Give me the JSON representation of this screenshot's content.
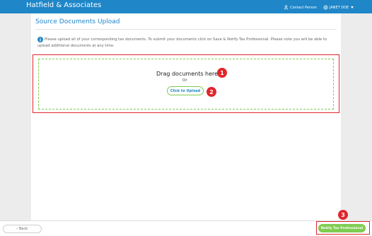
{
  "header": {
    "brand": "Hatfield & Associates",
    "contact_label": "Contact Person",
    "user_label": "JANET DOE",
    "icons": {
      "contact": "person-icon",
      "user": "settings-gear-icon",
      "user_menu": "chevron-down-icon"
    }
  },
  "page": {
    "title": "Source Documents Upload",
    "info": "Please upload all of your corresponding tax documents. To submit your documents click on Save & Notify Tax Professional. Please note you will be able to upload additional documents at any time.",
    "info_icon": "info-icon"
  },
  "upload": {
    "drag_text": "Drag documents here",
    "or_text": "Or",
    "click_label": "Click to Upload"
  },
  "annotations": {
    "one": "1",
    "two": "2",
    "three": "3"
  },
  "footer": {
    "back_label": "Back",
    "notify_label": "Notify Tax Professional"
  },
  "colors": {
    "header": "#1f86c8",
    "accent_green": "#7fcc52",
    "highlight_red": "#e0262c",
    "background": "#ececec"
  }
}
